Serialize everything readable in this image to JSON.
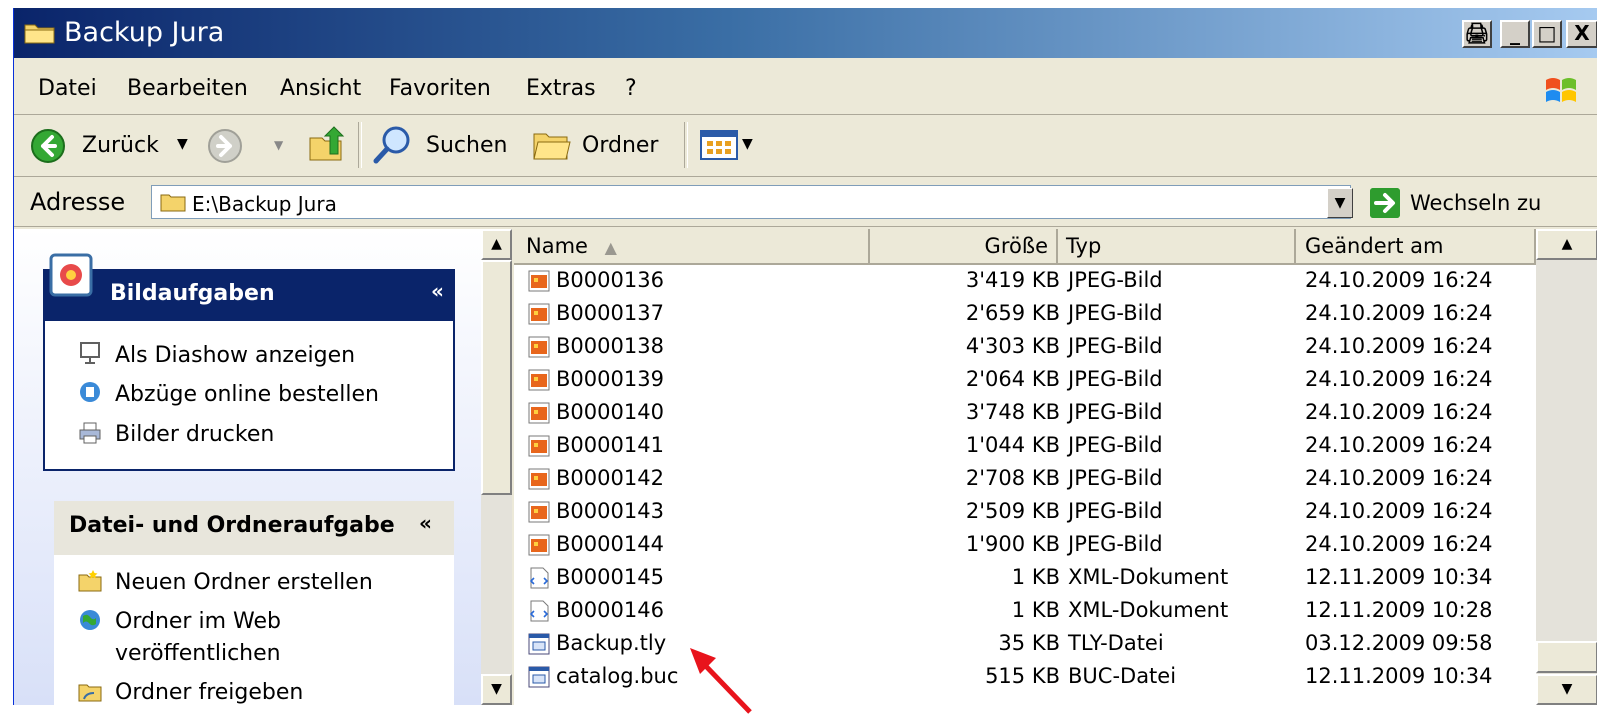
{
  "window": {
    "title": "Backup Jura",
    "controls": {
      "print": "🖨",
      "minimize": "_",
      "maximize": "□",
      "close": "X"
    }
  },
  "menu": [
    {
      "label": "Datei"
    },
    {
      "label": "Bearbeiten"
    },
    {
      "label": "Ansicht"
    },
    {
      "label": "Favoriten"
    },
    {
      "label": "Extras"
    },
    {
      "label": "?"
    }
  ],
  "toolbar": {
    "back_label": "Zurück",
    "search_label": "Suchen",
    "folders_label": "Ordner"
  },
  "address": {
    "label": "Adresse",
    "value": "E:\\Backup Jura",
    "go_label": "Wechseln zu"
  },
  "tasks": {
    "picture_tasks": {
      "title": "Bildaufgaben",
      "items": [
        {
          "label": "Als Diashow anzeigen"
        },
        {
          "label": "Abzüge online bestellen"
        },
        {
          "label": "Bilder drucken"
        }
      ]
    },
    "file_tasks": {
      "title": "Datei- und Ordneraufgabe",
      "items": [
        {
          "label": "Neuen Ordner erstellen"
        },
        {
          "label": "Ordner im Web"
        },
        {
          "label": "veröffentlichen"
        },
        {
          "label": "Ordner freigeben"
        }
      ]
    }
  },
  "files": {
    "columns": {
      "name": "Name",
      "size": "Größe",
      "type": "Typ",
      "modified": "Geändert am"
    },
    "rows": [
      {
        "name": "B0000136",
        "size": "3'419 KB",
        "type": "JPEG-Bild",
        "modified": "24.10.2009 16:24",
        "icon": "jpeg-file-icon"
      },
      {
        "name": "B0000137",
        "size": "2'659 KB",
        "type": "JPEG-Bild",
        "modified": "24.10.2009 16:24",
        "icon": "jpeg-file-icon"
      },
      {
        "name": "B0000138",
        "size": "4'303 KB",
        "type": "JPEG-Bild",
        "modified": "24.10.2009 16:24",
        "icon": "jpeg-file-icon"
      },
      {
        "name": "B0000139",
        "size": "2'064 KB",
        "type": "JPEG-Bild",
        "modified": "24.10.2009 16:24",
        "icon": "jpeg-file-icon"
      },
      {
        "name": "B0000140",
        "size": "3'748 KB",
        "type": "JPEG-Bild",
        "modified": "24.10.2009 16:24",
        "icon": "jpeg-file-icon"
      },
      {
        "name": "B0000141",
        "size": "1'044 KB",
        "type": "JPEG-Bild",
        "modified": "24.10.2009 16:24",
        "icon": "jpeg-file-icon"
      },
      {
        "name": "B0000142",
        "size": "2'708 KB",
        "type": "JPEG-Bild",
        "modified": "24.10.2009 16:24",
        "icon": "jpeg-file-icon"
      },
      {
        "name": "B0000143",
        "size": "2'509 KB",
        "type": "JPEG-Bild",
        "modified": "24.10.2009 16:24",
        "icon": "jpeg-file-icon"
      },
      {
        "name": "B0000144",
        "size": "1'900 KB",
        "type": "JPEG-Bild",
        "modified": "24.10.2009 16:24",
        "icon": "jpeg-file-icon"
      },
      {
        "name": "B0000145",
        "size": "1 KB",
        "type": "XML-Dokument",
        "modified": "12.11.2009 10:34",
        "icon": "xml-file-icon"
      },
      {
        "name": "B0000146",
        "size": "1 KB",
        "type": "XML-Dokument",
        "modified": "12.11.2009 10:28",
        "icon": "xml-file-icon"
      },
      {
        "name": "Backup.tly",
        "size": "35 KB",
        "type": "TLY-Datei",
        "modified": "03.12.2009 09:58",
        "icon": "generic-file-icon"
      },
      {
        "name": "catalog.buc",
        "size": "515 KB",
        "type": "BUC-Datei",
        "modified": "12.11.2009 10:34",
        "icon": "generic-file-icon"
      }
    ]
  },
  "colors": {
    "title_start": "#0a246a",
    "title_end": "#a6caf0",
    "chrome": "#ece9d8",
    "annotation_arrow": "#e8141c"
  }
}
